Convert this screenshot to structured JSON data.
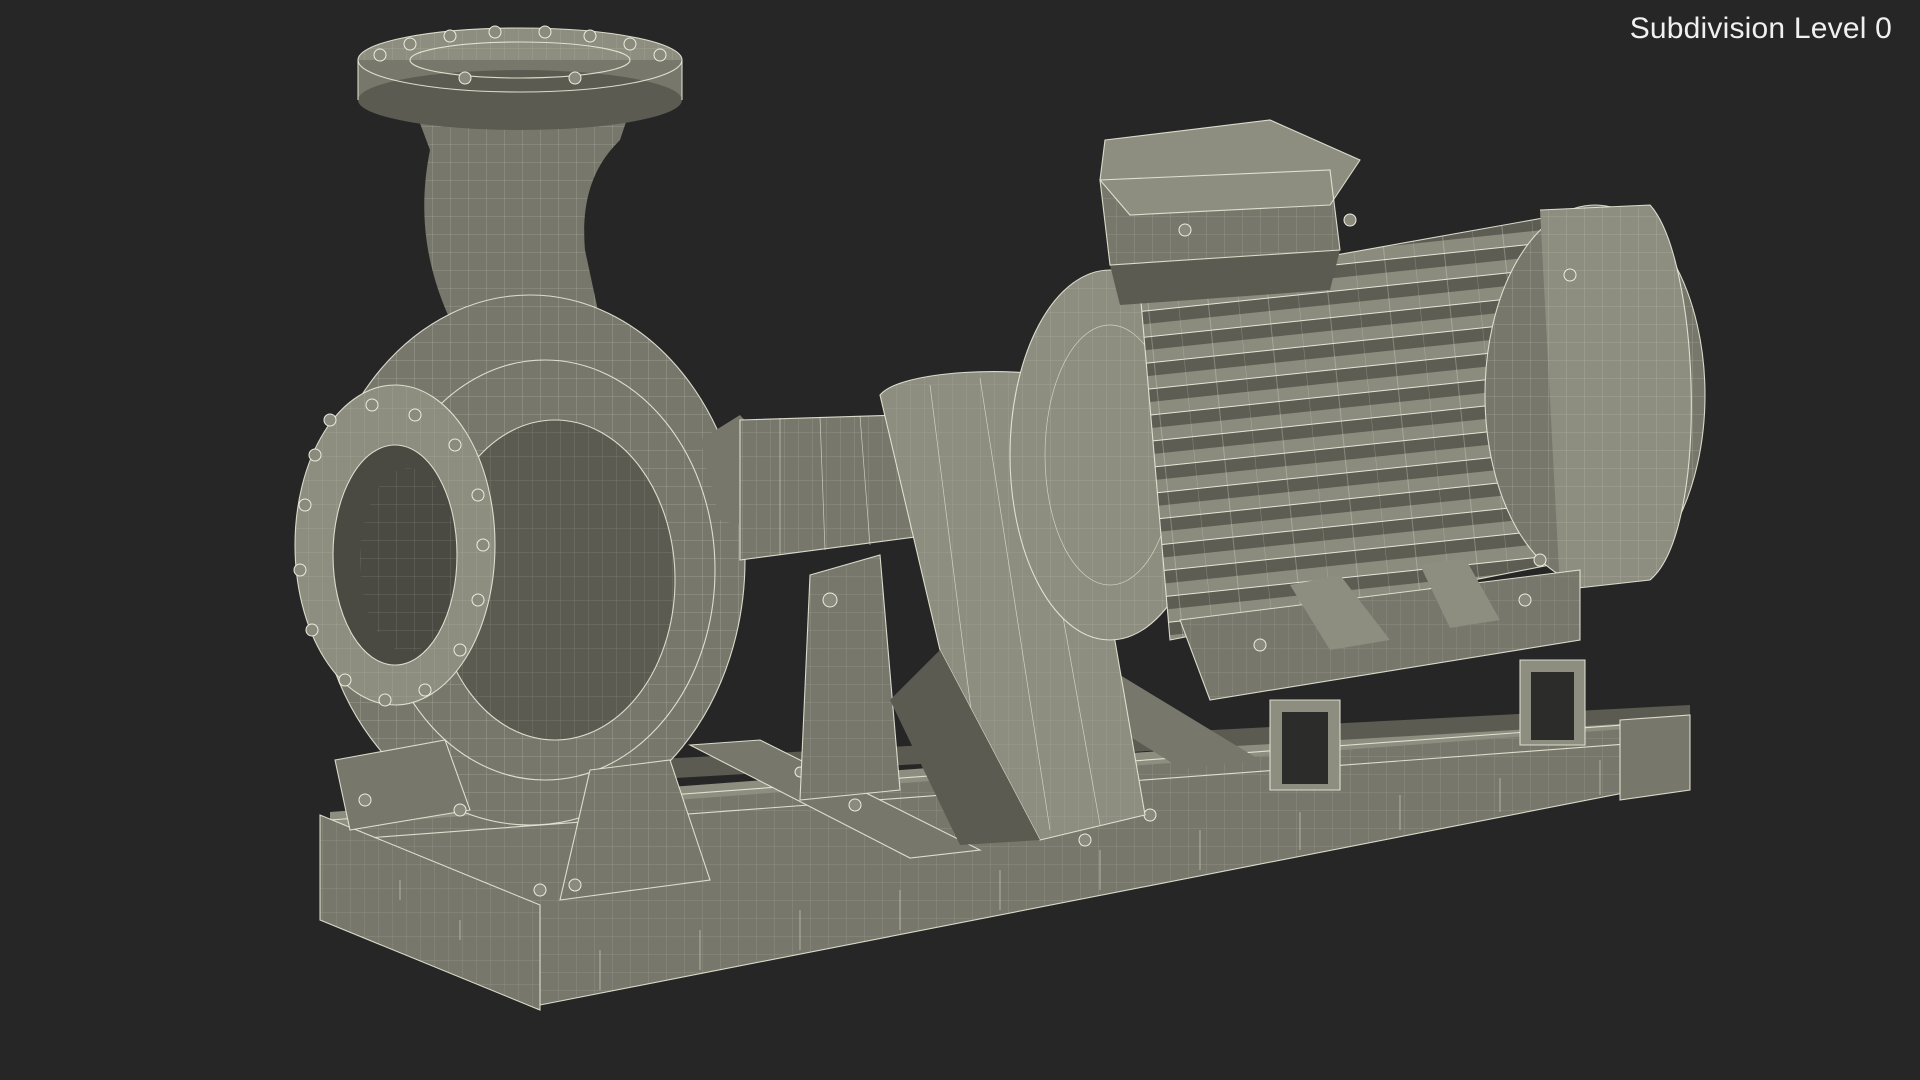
{
  "viewport": {
    "subdivision_label": "Subdivision Level 0",
    "background_color": "#262626",
    "model_color": "#77776b",
    "wire_color": "#e9e9d8"
  }
}
